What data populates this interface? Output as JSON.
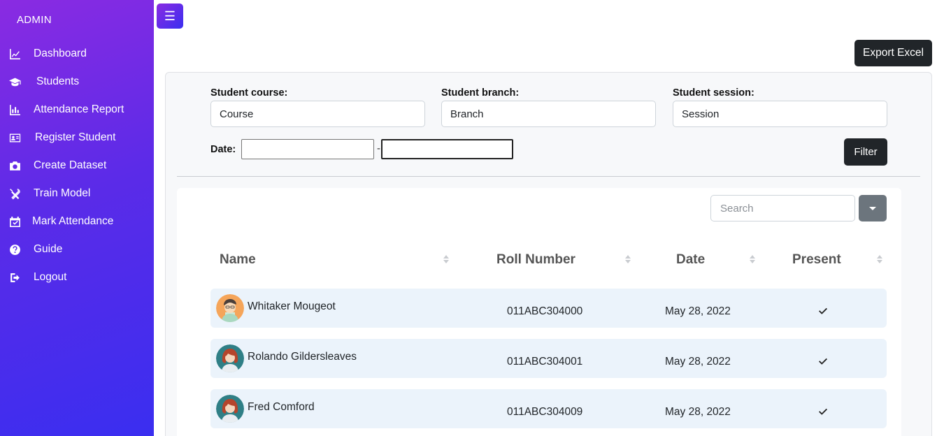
{
  "sidebar": {
    "brand": "ADMIN",
    "items": [
      {
        "label": "Dashboard",
        "icon": "chart-line-icon"
      },
      {
        "label": "Students",
        "icon": "graduation-cap-icon"
      },
      {
        "label": "Attendance Report",
        "icon": "bar-chart-icon"
      },
      {
        "label": "Register Student",
        "icon": "id-card-icon"
      },
      {
        "label": "Create Dataset",
        "icon": "camera-icon"
      },
      {
        "label": "Train Model",
        "icon": "tools-icon"
      },
      {
        "label": "Mark Attendance",
        "icon": "calendar-check-icon"
      },
      {
        "label": "Guide",
        "icon": "question-circle-icon"
      },
      {
        "label": "Logout",
        "icon": "sign-out-icon"
      }
    ]
  },
  "toolbar": {
    "toggle_icon": "☰",
    "export_label": "Export Excel"
  },
  "filters": {
    "course_label": "Student course:",
    "course_value": "Course",
    "branch_label": "Student branch:",
    "branch_value": "Branch",
    "session_label": "Student session:",
    "session_value": "Session",
    "date_label": "Date:",
    "date_separator": "-",
    "date_from": "",
    "date_to": "",
    "filter_label": "Filter"
  },
  "table": {
    "search_placeholder": "Search",
    "columns": [
      "Name",
      "Roll Number",
      "Date",
      "Present"
    ],
    "rows": [
      {
        "name": "Whitaker Mougeot",
        "roll": "011ABC304000",
        "date": "May 28, 2022",
        "present": "✓",
        "avatar": "male"
      },
      {
        "name": "Rolando Gildersleaves",
        "roll": "011ABC304001",
        "date": "May 28, 2022",
        "present": "✓",
        "avatar": "female"
      },
      {
        "name": "Fred Comford",
        "roll": "011ABC304009",
        "date": "May 28, 2022",
        "present": "✓",
        "avatar": "female"
      }
    ]
  },
  "colors": {
    "sidebar_start": "#8a2be2",
    "sidebar_end": "#3a2ef0",
    "dark_button": "#212529",
    "row_bg": "#ebf3fb"
  }
}
